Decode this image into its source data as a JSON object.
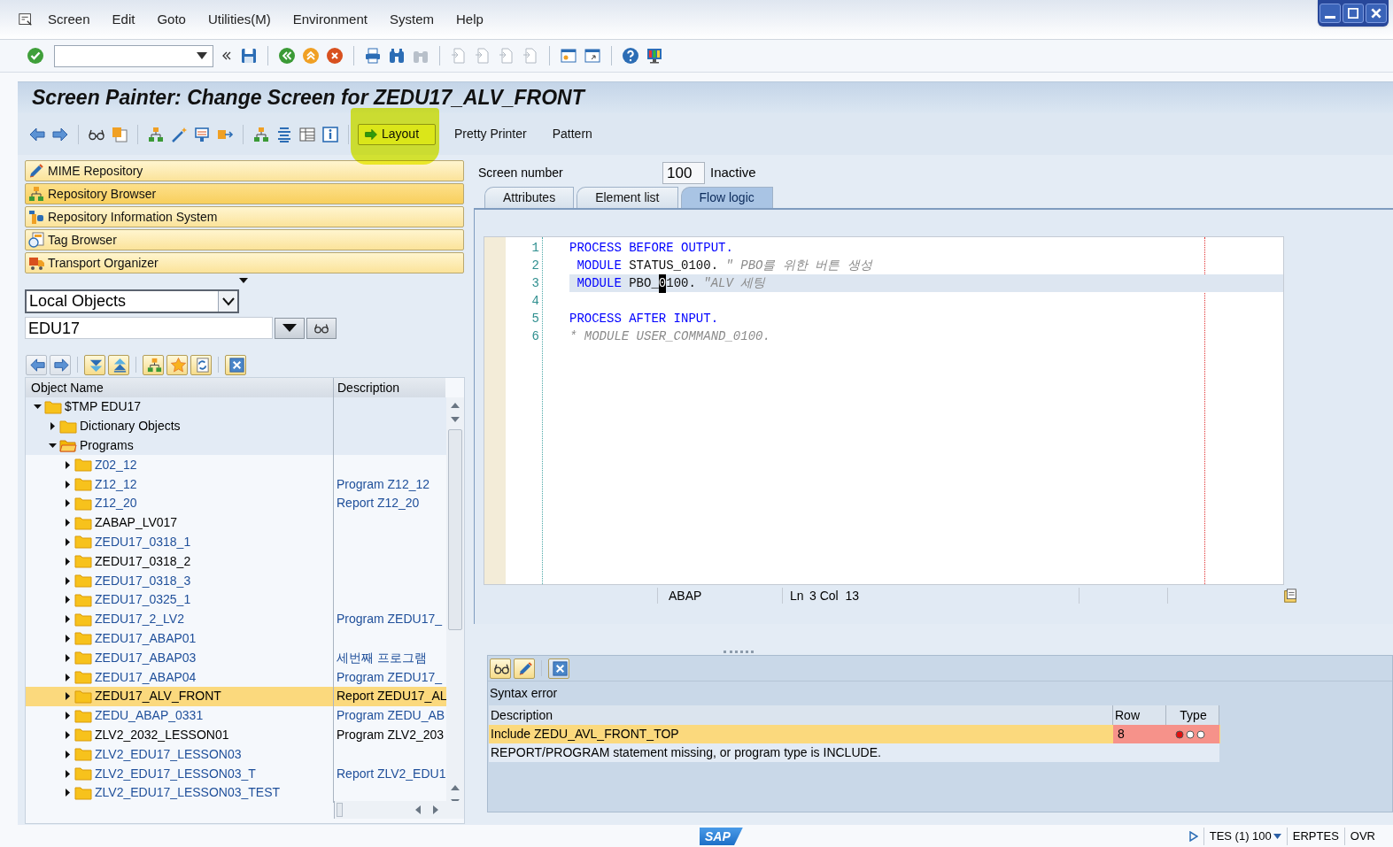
{
  "menu_bar": [
    "Screen",
    "Edit",
    "Goto",
    "Utilities(M)",
    "Environment",
    "System",
    "Help"
  ],
  "title": "Screen Painter: Change Screen for ZEDU17_ALV_FRONT",
  "app_toolbar": [
    {
      "label": "Layout",
      "kind": "framed",
      "marked": true
    },
    {
      "label": "Pretty Printer",
      "kind": "text",
      "marked": false
    },
    {
      "label": "Pattern",
      "kind": "text",
      "marked": false
    }
  ],
  "navigation": [
    {
      "label": "MIME Repository",
      "selected": false
    },
    {
      "label": "Repository Browser",
      "selected": true
    },
    {
      "label": "Repository Information System",
      "selected": false
    },
    {
      "label": "Tag Browser",
      "selected": false
    },
    {
      "label": "Transport Organizer",
      "selected": false
    }
  ],
  "object_list": {
    "type": "Local Objects",
    "name": "EDU17"
  },
  "tree": {
    "columns": [
      "Object Name",
      "Description"
    ],
    "nodes": [
      {
        "name": "$TMP EDU17",
        "active": true,
        "expanded": true,
        "selected": false,
        "children": [
          {
            "name": "Dictionary Objects",
            "active": true,
            "expanded": false,
            "selected": false
          },
          {
            "name": "Programs",
            "active": true,
            "expanded": true,
            "selected": false,
            "children": [
              {
                "name": "Z02_12",
                "active": false,
                "expanded": false,
                "selected": false
              },
              {
                "name": "Z12_12",
                "description": "Program Z12_12",
                "active": false,
                "expanded": false,
                "selected": false
              },
              {
                "name": "Z12_20",
                "description": "Report Z12_20",
                "active": false,
                "expanded": false,
                "selected": false
              },
              {
                "name": "ZABAP_LV017",
                "active": true,
                "expanded": false,
                "selected": false
              },
              {
                "name": "ZEDU17_0318_1",
                "active": false,
                "expanded": false,
                "selected": false
              },
              {
                "name": "ZEDU17_0318_2",
                "active": true,
                "expanded": false,
                "selected": false
              },
              {
                "name": "ZEDU17_0318_3",
                "active": false,
                "expanded": false,
                "selected": false
              },
              {
                "name": "ZEDU17_0325_1",
                "active": false,
                "expanded": false,
                "selected": false
              },
              {
                "name": "ZEDU17_2_LV2",
                "description": "Program ZEDU17_",
                "active": false,
                "expanded": false,
                "selected": false
              },
              {
                "name": "ZEDU17_ABAP01",
                "active": false,
                "expanded": false,
                "selected": false
              },
              {
                "name": "ZEDU17_ABAP03",
                "description": "세번째 프로그램",
                "active": false,
                "expanded": false,
                "selected": false
              },
              {
                "name": "ZEDU17_ABAP04",
                "description": "Program ZEDU17_",
                "active": false,
                "expanded": false,
                "selected": false
              },
              {
                "name": "ZEDU17_ALV_FRONT",
                "description": "Report ZEDU17_AL",
                "active": true,
                "expanded": false,
                "selected": true
              },
              {
                "name": "ZEDU_ABAP_0331",
                "description": "Program ZEDU_AB",
                "active": false,
                "expanded": false,
                "selected": false
              },
              {
                "name": "ZLV2_2032_LESSON01",
                "description": "Program ZLV2_203",
                "active": true,
                "expanded": false,
                "selected": false
              },
              {
                "name": "ZLV2_EDU17_LESSON03",
                "active": false,
                "expanded": false,
                "selected": false
              },
              {
                "name": "ZLV2_EDU17_LESSON03_T",
                "description": "Report ZLV2_EDU1",
                "active": false,
                "expanded": false,
                "selected": false
              },
              {
                "name": "ZLV2_EDU17_LESSON03_TEST",
                "active": false,
                "expanded": false,
                "selected": false
              }
            ]
          }
        ]
      }
    ]
  },
  "screen": {
    "label": "Screen number",
    "number": "100",
    "status": "Inactive"
  },
  "tabs": [
    {
      "label": "Attributes",
      "selected": false
    },
    {
      "label": "Element list",
      "selected": false
    },
    {
      "label": "Flow logic",
      "selected": true
    }
  ],
  "editor": {
    "lines": [
      {
        "number": "1",
        "current": false,
        "tokens": [
          {
            "text": "PROCESS BEFORE OUTPUT.",
            "kind": "keyword"
          }
        ]
      },
      {
        "number": "2",
        "current": false,
        "tokens": [
          {
            "text": " MODULE",
            "kind": "keyword"
          },
          {
            "text": " STATUS_0100. ",
            "kind": "plain"
          },
          {
            "text": "\" PBO를 위한 버튼 생성",
            "kind": "comment"
          }
        ]
      },
      {
        "number": "3",
        "current": true,
        "tokens": [
          {
            "text": " MODULE",
            "kind": "keyword"
          },
          {
            "text": " PBO_",
            "kind": "plain"
          },
          {
            "text": "0",
            "kind": "cursor"
          },
          {
            "text": "100. ",
            "kind": "plain"
          },
          {
            "text": "\"ALV 세팅",
            "kind": "comment"
          }
        ]
      },
      {
        "number": "4",
        "current": false
      },
      {
        "number": "5",
        "current": false,
        "tokens": [
          {
            "text": "PROCESS AFTER INPUT.",
            "kind": "keyword"
          }
        ]
      },
      {
        "number": "6",
        "current": false,
        "tokens": [
          {
            "text": "* MODULE USER_COMMAND_0100.",
            "kind": "comment"
          }
        ]
      }
    ],
    "language": "ABAP",
    "line_label": "Ln",
    "position": "3 Col  13"
  },
  "messages": {
    "title": "Syntax error",
    "columns": [
      "Description",
      "Row",
      "Type"
    ],
    "rows": [
      {
        "description": "Include ZEDU_AVL_FRONT_TOP",
        "row": "8",
        "kind": "error",
        "selected": true
      },
      {
        "description": "REPORT/PROGRAM statement missing, or program type is INCLUDE.",
        "selected": false
      }
    ]
  },
  "status_bar": {
    "logo": "SAP",
    "session": "TES (1) 100",
    "client": "ERPTES",
    "mode": "OVR"
  }
}
